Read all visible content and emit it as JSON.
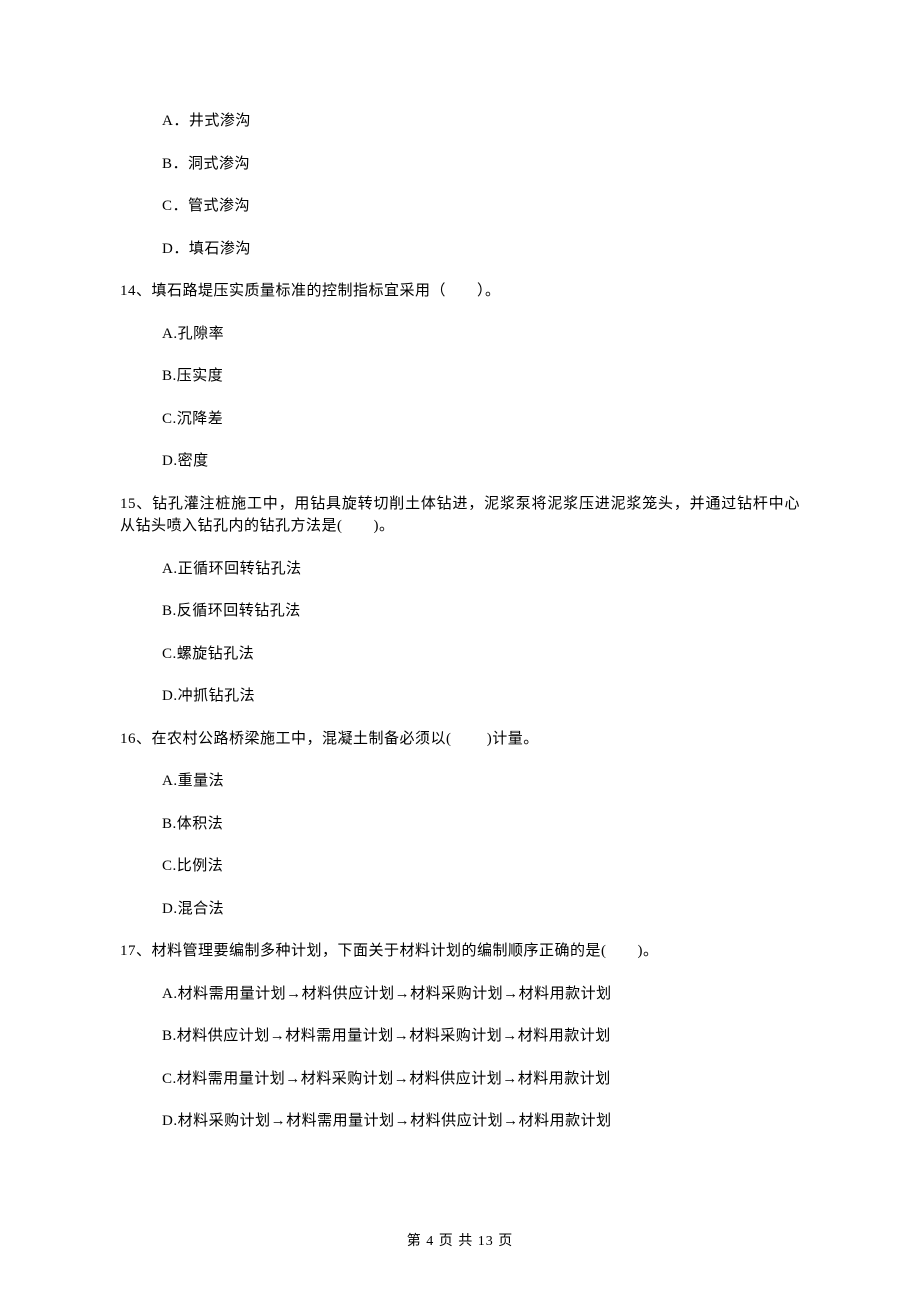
{
  "orphanOptions": {
    "a": "A．井式渗沟",
    "b": "B．洞式渗沟",
    "c": "C．管式渗沟",
    "d": "D．填石渗沟"
  },
  "q14": {
    "stem": "14、填石路堤压实质量标准的控制指标宜采用（　　）。",
    "a": "A.孔隙率",
    "b": "B.压实度",
    "c": "C.沉降差",
    "d": "D.密度"
  },
  "q15": {
    "stem": "15、钻孔灌注桩施工中，用钻具旋转切削土体钻进，泥浆泵将泥浆压进泥浆笼头，并通过钻杆中心从钻头喷入钻孔内的钻孔方法是(　　)。",
    "a": "A.正循环回转钻孔法",
    "b": "B.反循环回转钻孔法",
    "c": "C.螺旋钻孔法",
    "d": "D.冲抓钻孔法"
  },
  "q16": {
    "stem": "16、在农村公路桥梁施工中，混凝土制备必须以(　　 )计量。",
    "a": "A.重量法",
    "b": "B.体积法",
    "c": "C.比例法",
    "d": "D.混合法"
  },
  "q17": {
    "stem": "17、材料管理要编制多种计划，下面关于材料计划的编制顺序正确的是(　　)。",
    "a": "A.材料需用量计划→材料供应计划→材料采购计划→材料用款计划",
    "b": "B.材料供应计划→材料需用量计划→材料采购计划→材料用款计划",
    "c": "C.材料需用量计划→材料采购计划→材料供应计划→材料用款计划",
    "d": "D.材料采购计划→材料需用量计划→材料供应计划→材料用款计划"
  },
  "footer": "第 4 页 共 13 页"
}
